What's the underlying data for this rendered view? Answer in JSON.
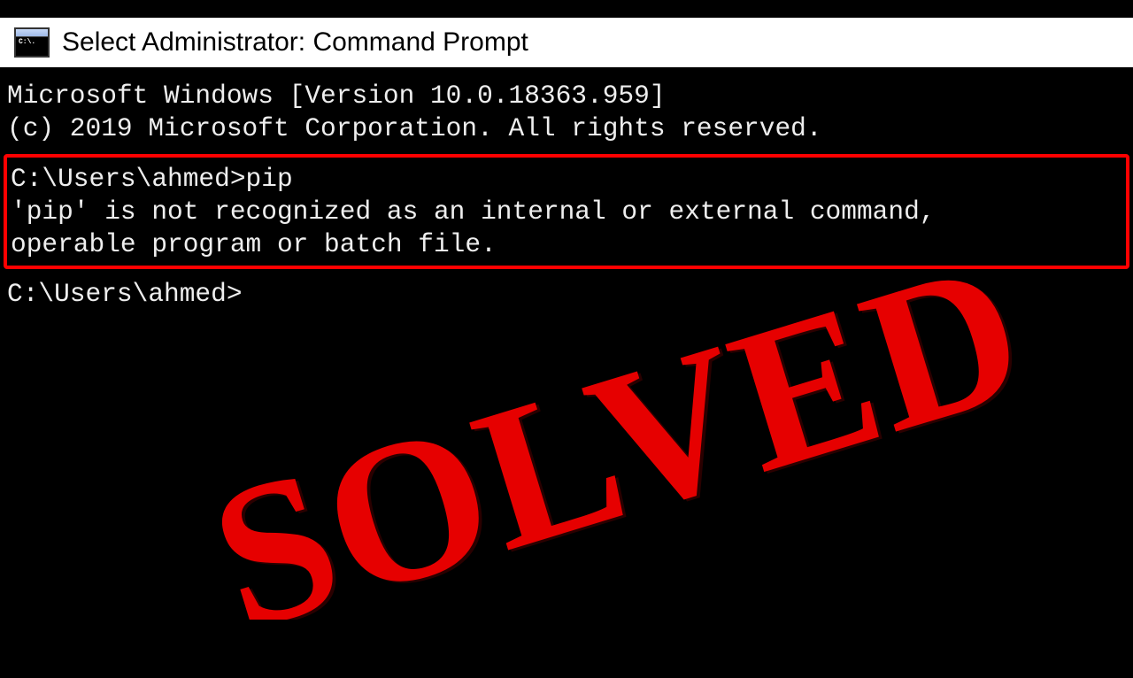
{
  "titlebar": {
    "text": "Select Administrator: Command Prompt",
    "icon_glyph": "C:\\."
  },
  "terminal": {
    "banner_line1": "Microsoft Windows [Version 10.0.18363.959]",
    "banner_line2": "(c) 2019 Microsoft Corporation. All rights reserved.",
    "prompt1": "C:\\Users\\ahmed>",
    "command1": "pip",
    "error_line1": "'pip' is not recognized as an internal or external command,",
    "error_line2": "operable program or batch file.",
    "prompt2": "C:\\Users\\ahmed>"
  },
  "overlay": {
    "stamp_text": "SOLVED"
  }
}
